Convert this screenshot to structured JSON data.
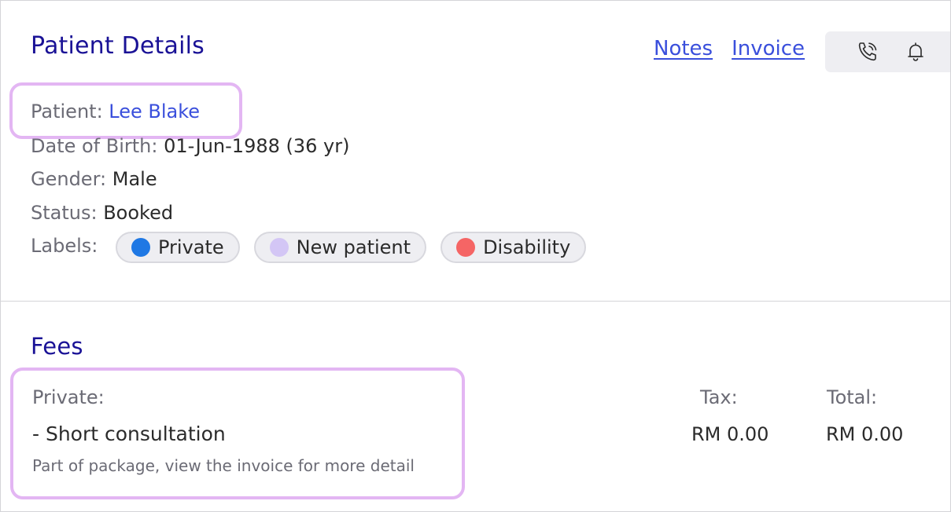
{
  "patient_section": {
    "title": "Patient Details",
    "links": {
      "notes": "Notes",
      "invoice": "Invoice"
    },
    "toolbar_icons": [
      "phone-icon",
      "bell-icon"
    ],
    "patient_label": "Patient:",
    "patient_name": "Lee Blake",
    "dob_label": "Date of Birth:",
    "dob_value": "01-Jun-1988 (36 yr)",
    "gender_label": "Gender:",
    "gender_value": "Male",
    "status_label": "Status:",
    "status_value": "Booked",
    "labels_label": "Labels:",
    "labels": [
      {
        "text": "Private",
        "color": "#1f78e4"
      },
      {
        "text": "New patient",
        "color": "#d3c6f5"
      },
      {
        "text": "Disability",
        "color": "#f56565"
      }
    ]
  },
  "fees_section": {
    "title": "Fees",
    "category_label": "Private:",
    "item_name": "- Short consultation",
    "item_note": "Part of package, view the invoice for more detail",
    "tax_label": "Tax:",
    "total_label": "Total:",
    "tax_value": "RM 0.00",
    "total_value": "RM 0.00"
  },
  "colors": {
    "title": "#1a1296",
    "link": "#3a4fdc",
    "highlight": "#e3b6f3",
    "muted": "#6b6b75"
  }
}
